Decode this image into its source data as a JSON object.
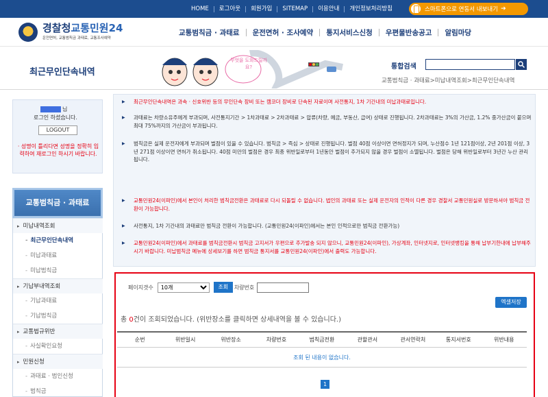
{
  "topbar": {
    "links": [
      "HOME",
      "로그아웃",
      "회원가입",
      "SITEMAP",
      "이용안내",
      "개인정보처리방침"
    ],
    "smartphone_label": "스마트폰으로 연동서 내보내기",
    "colors": {
      "bar": "#1c4d8f",
      "smart": "#f39800"
    }
  },
  "header": {
    "logo_main": "경찰청",
    "logo_brand": "교통민원24",
    "logo_sub": "운전면허, 교통범칙금 과태료, 교통조사예약",
    "nav": [
      "교통범칙금 · 과태료",
      "운전면허 · 조사예약",
      "통지서비스신청",
      "우편물반송공고",
      "알림마당"
    ]
  },
  "visual": {
    "page_title": "최근무인단속내역",
    "speech_bubble": "무엇을 도와드릴까요?",
    "search_label": "통합검색",
    "breadcrumb": "교통범칙금 · 과태료>미납내역조회>최근무인단속내역"
  },
  "login": {
    "user_suffix": "님",
    "message": "로그인 하셨습니다.",
    "logout_label": "LOGOUT",
    "warning": "· 성명이 틀리다면 성명을 정확히 입력하여 재로그인 하시기 바랍니다."
  },
  "lnb": {
    "title": "교통범칙금 · 과태료",
    "items": [
      {
        "type": "main",
        "label": "미납내역조회"
      },
      {
        "type": "sub",
        "label": "최근무인단속내역",
        "active": true
      },
      {
        "type": "sub",
        "label": "미납과태료"
      },
      {
        "type": "sub",
        "label": "미납범칙금"
      },
      {
        "type": "main",
        "label": "기납부내역조회"
      },
      {
        "type": "sub",
        "label": "기납과태료"
      },
      {
        "type": "sub",
        "label": "기납범칙금"
      },
      {
        "type": "main",
        "label": "교통법규위반"
      },
      {
        "type": "sub",
        "label": "사실확인요청"
      },
      {
        "type": "main",
        "label": "민원신청"
      },
      {
        "type": "sub",
        "label": "과태료 · 범인신청"
      },
      {
        "type": "sub",
        "label": "범칙금"
      }
    ]
  },
  "info": [
    {
      "red": true,
      "text": "최근무인단속내역은 과속 · 신호위반 등의 무인단속 장비 또는 캠코더 장비로 단속된 자료이며 사전통지, 1차 기간내의 미납과태료입니다."
    },
    {
      "red": false,
      "text": "과태료는 차량소유주에게 부과되며, 사전통지기간 > 1차과태료 > 2차과태료 > 압류(차량, 예금, 부동산, 급여) 상태로 진행됩니다. 2차과태료는 3%의 가산금, 1.2% 중가산금이 붙으며 최대 75%까지의 가산금이 부과됩니다."
    },
    {
      "red": false,
      "text": "범칙금은 실제 운전자에게 부과되며 벌점이 있을 수 있습니다. 범칙금 > 즉심 > 상태로 진행됩니다. 벌점 40점 이상이면 면허정지가 되며, 누산점수 1년 121점이상, 2년 201점 이상, 3년 271점 이상이면 면허가 취소됩니다. 40점 미만의 벌점은 경우 최종 위반일로부터 1년동안 벌점이 추가되지 않을 경우 벌점이 소멸됩니다. 벌점은 당해 위반일로부터 3년간 누산 관리됩니다."
    },
    {
      "red": true,
      "text": "교통민원24(이파인)에서 본인이 처리한 범칙금전환은 과태료로 다시 되돌릴 수 없습니다. 법인의 과태료 또는 실제 운전자의 인적이 다른 경우 경찰서 교통민원실로 방문하셔야 범칙금 전환이 가능합니다."
    },
    {
      "red": false,
      "text": "사전통지, 1차 기간내의 과태료만 범칙금 전환이 가능합니다. (교통민원24(이파인)에서는 본인 인적으로만 범칙금 전환가능)"
    },
    {
      "red": true,
      "text": "교통민원24(이파인)에서 과태료를 범칙금전환시 범칙금 고지서가 우편으로 추가발송 되지 않으니, 교통민원24(이파인), 가상계좌, 인터넷지로, 인터넷뱅킹을 통해 납부기한내에 납부해주시기 바랍니다. 미납범칙금 메뉴에 상세보기를 하면 범칙금 통지서를 교통민원24(이파인)에서 출력도 가능합니다."
    }
  ],
  "result": {
    "rows_label": "페이지갯수",
    "rows_value": "10개",
    "query_label": "조회",
    "car_label": "차량번호",
    "excel_label": "엑셀저장",
    "count_prefix": "총 ",
    "count": "0",
    "count_suffix": "건이 조회되었습니다. (위반장소를 클릭하면 상세내역을 볼 수 있습니다.)",
    "columns": [
      "순번",
      "위반일시",
      "위반장소",
      "차량번호",
      "범칙금전환",
      "관할관서",
      "관서연락처",
      "통지서번호",
      "위반내용"
    ],
    "empty_message": "조회 된 내용이 없습니다.",
    "page": "1",
    "accent": "#e60012",
    "button_color": "#1f74c8"
  }
}
